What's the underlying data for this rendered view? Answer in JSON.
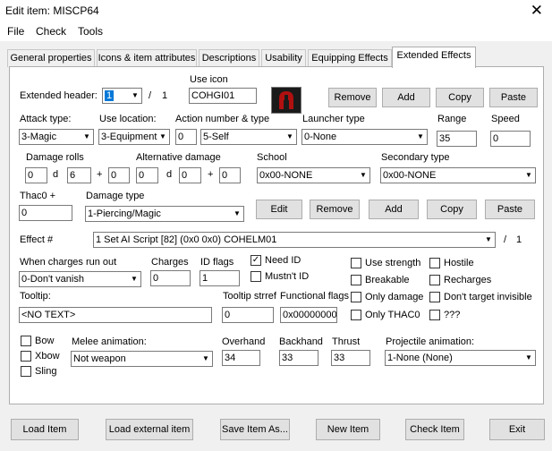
{
  "window": {
    "title": "Edit item: MISCP64"
  },
  "menu": [
    "File",
    "Check",
    "Tools"
  ],
  "tabs": [
    "General properties",
    "Icons & item attributes",
    "Descriptions",
    "Usability",
    "Equipping Effects",
    "Extended Effects"
  ],
  "header": {
    "label": "Extended header:",
    "value": "1",
    "sep": "/",
    "total": "1"
  },
  "use_icon": {
    "label": "Use icon",
    "value": "COHGI01"
  },
  "buttons_top": [
    "Remove",
    "Add",
    "Copy",
    "Paste"
  ],
  "attack_type": {
    "label": "Attack type:",
    "value": "3-Magic"
  },
  "use_location": {
    "label": "Use location:",
    "value": "3-Equipment"
  },
  "action": {
    "label": "Action number & type",
    "num": "0",
    "type": "5-Self"
  },
  "launcher": {
    "label": "Launcher type",
    "value": "0-None"
  },
  "range": {
    "label": "Range",
    "value": "35"
  },
  "speed": {
    "label": "Speed",
    "value": "0"
  },
  "damage_rolls": {
    "label": "Damage rolls",
    "a": "0",
    "d": "d",
    "b": "6",
    "plus": "+",
    "c": "0"
  },
  "alt_damage": {
    "label": "Alternative damage",
    "a": "0",
    "d": "d",
    "b": "0",
    "plus": "+",
    "c": "0"
  },
  "school": {
    "label": "School",
    "value": "0x00-NONE"
  },
  "secondary": {
    "label": "Secondary type",
    "value": "0x00-NONE"
  },
  "thac0": {
    "label": "Thac0 +",
    "value": "0"
  },
  "damage_type": {
    "label": "Damage type",
    "value": "1-Piercing/Magic"
  },
  "buttons_mid": [
    "Edit",
    "Remove",
    "Add",
    "Copy",
    "Paste"
  ],
  "effect": {
    "label": "Effect #",
    "value": "1 Set AI Script [82] (0x0 0x0) COHELM01",
    "sep": "/",
    "total": "1"
  },
  "charges_out": {
    "label": "When charges run out",
    "value": "0-Don't vanish"
  },
  "charges": {
    "label": "Charges",
    "value": "0"
  },
  "id_flags": {
    "label": "ID flags",
    "value": "1"
  },
  "need_id": {
    "label": "Need ID",
    "checked": true
  },
  "mustnt_id": {
    "label": "Mustn't ID",
    "checked": false
  },
  "checks_col1": [
    {
      "label": "Use strength",
      "checked": false
    },
    {
      "label": "Breakable",
      "checked": false
    },
    {
      "label": "Only damage",
      "checked": false
    },
    {
      "label": "Only THAC0",
      "checked": false
    }
  ],
  "checks_col2": [
    {
      "label": "Hostile",
      "checked": false
    },
    {
      "label": "Recharges",
      "checked": false
    },
    {
      "label": "Don't target invisible",
      "checked": false
    },
    {
      "label": "???",
      "checked": false
    }
  ],
  "tooltip": {
    "label": "Tooltip:",
    "value": "<NO TEXT>"
  },
  "tooltip_strref": {
    "label": "Tooltip strref",
    "value": "0"
  },
  "functional_flags": {
    "label": "Functional flags",
    "value": "0x00000000"
  },
  "weapon_checks": [
    {
      "label": "Bow",
      "checked": false
    },
    {
      "label": "Xbow",
      "checked": false
    },
    {
      "label": "Sling",
      "checked": false
    }
  ],
  "melee_anim": {
    "label": "Melee animation:",
    "value": "Not weapon"
  },
  "overhand": {
    "label": "Overhand",
    "value": "34"
  },
  "backhand": {
    "label": "Backhand",
    "value": "33"
  },
  "thrust": {
    "label": "Thrust",
    "value": "33"
  },
  "projectile": {
    "label": "Projectile animation:",
    "value": "1-None (None)"
  },
  "bottom_buttons": [
    "Load Item",
    "Load external item",
    "Save Item As...",
    "New Item",
    "Check Item",
    "Exit"
  ],
  "icon": "helmet-item-icon",
  "colors": {
    "accent": "#0078d7",
    "icon_red": "#b01010"
  }
}
